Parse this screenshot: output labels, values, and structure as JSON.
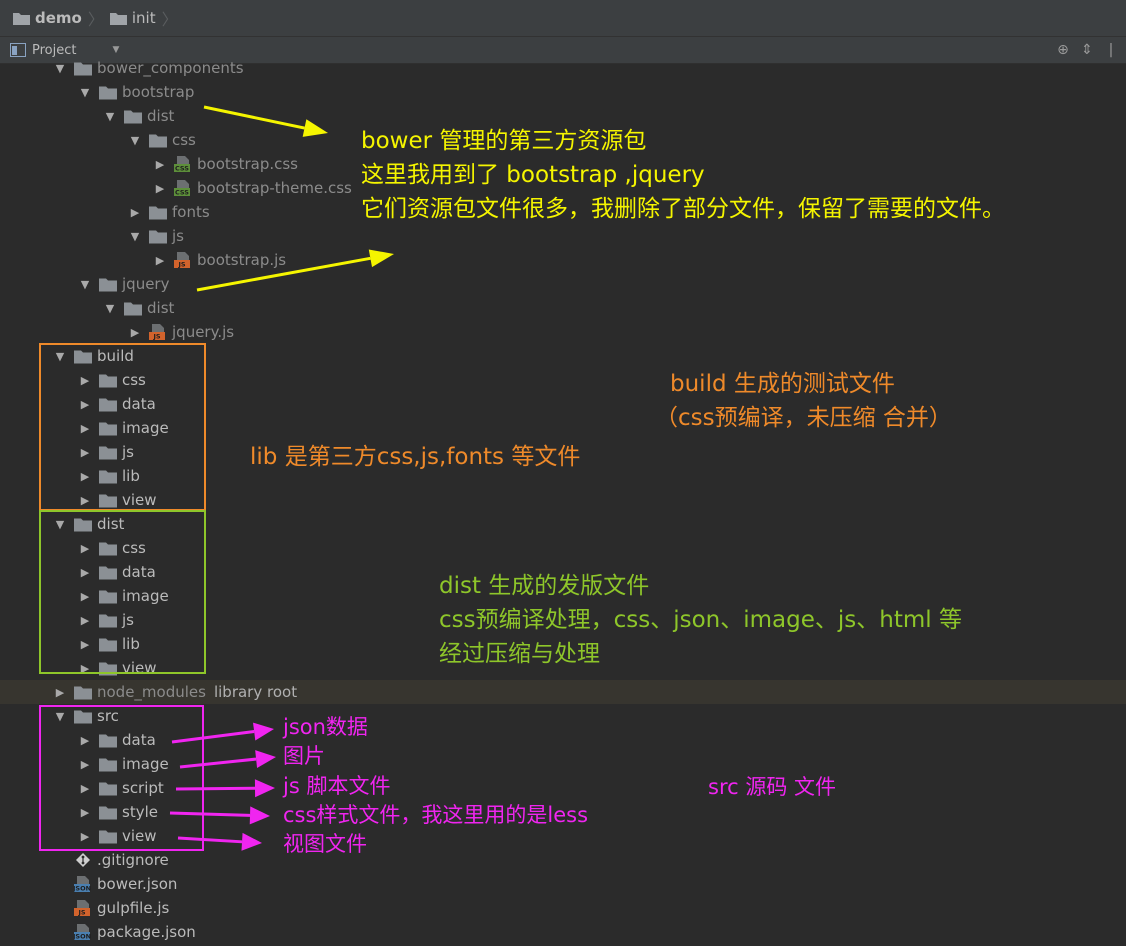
{
  "breadcrumb": {
    "items": [
      "demo",
      "init"
    ]
  },
  "toolbar": {
    "project_label": "Project"
  },
  "tree": [
    {
      "label": "bower_components",
      "icon": "folder-icon",
      "expanded": true,
      "depth": 0,
      "dim": true
    },
    {
      "label": "bootstrap",
      "icon": "folder-icon",
      "expanded": true,
      "depth": 1,
      "dim": true
    },
    {
      "label": "dist",
      "icon": "folder-icon",
      "expanded": true,
      "depth": 2,
      "dim": true
    },
    {
      "label": "css",
      "icon": "folder-icon",
      "expanded": true,
      "depth": 3,
      "dim": true
    },
    {
      "label": "bootstrap.css",
      "icon": "css-file-icon",
      "expanded": false,
      "depth": 4,
      "dim": true
    },
    {
      "label": "bootstrap-theme.css",
      "icon": "css-file-icon",
      "expanded": false,
      "depth": 4,
      "dim": true
    },
    {
      "label": "fonts",
      "icon": "folder-icon",
      "expanded": false,
      "depth": 3,
      "dim": true
    },
    {
      "label": "js",
      "icon": "folder-icon",
      "expanded": true,
      "depth": 3,
      "dim": true
    },
    {
      "label": "bootstrap.js",
      "icon": "js-file-icon",
      "expanded": false,
      "depth": 4,
      "dim": true
    },
    {
      "label": "jquery",
      "icon": "folder-icon",
      "expanded": true,
      "depth": 1,
      "dim": true
    },
    {
      "label": "dist",
      "icon": "folder-icon",
      "expanded": true,
      "depth": 2,
      "dim": true
    },
    {
      "label": "jquery.js",
      "icon": "js-file-icon",
      "expanded": false,
      "depth": 3,
      "dim": true
    },
    {
      "label": "build",
      "icon": "folder-icon",
      "expanded": true,
      "depth": 0
    },
    {
      "label": "css",
      "icon": "folder-icon",
      "expanded": false,
      "depth": 1
    },
    {
      "label": "data",
      "icon": "folder-icon",
      "expanded": false,
      "depth": 1
    },
    {
      "label": "image",
      "icon": "folder-icon",
      "expanded": false,
      "depth": 1
    },
    {
      "label": "js",
      "icon": "folder-icon",
      "expanded": false,
      "depth": 1
    },
    {
      "label": "lib",
      "icon": "folder-icon",
      "expanded": false,
      "depth": 1
    },
    {
      "label": "view",
      "icon": "folder-icon",
      "expanded": false,
      "depth": 1
    },
    {
      "label": "dist",
      "icon": "folder-icon",
      "expanded": true,
      "depth": 0
    },
    {
      "label": "css",
      "icon": "folder-icon",
      "expanded": false,
      "depth": 1
    },
    {
      "label": "data",
      "icon": "folder-icon",
      "expanded": false,
      "depth": 1
    },
    {
      "label": "image",
      "icon": "folder-icon",
      "expanded": false,
      "depth": 1
    },
    {
      "label": "js",
      "icon": "folder-icon",
      "expanded": false,
      "depth": 1
    },
    {
      "label": "lib",
      "icon": "folder-icon",
      "expanded": false,
      "depth": 1
    },
    {
      "label": "view",
      "icon": "folder-icon",
      "expanded": false,
      "depth": 1
    },
    {
      "label": "node_modules",
      "suffix": "library root",
      "icon": "folder-icon",
      "expanded": false,
      "depth": 0,
      "dim": true,
      "highlight": true
    },
    {
      "label": "src",
      "icon": "folder-icon",
      "expanded": true,
      "depth": 0
    },
    {
      "label": "data",
      "icon": "folder-icon",
      "expanded": false,
      "depth": 1
    },
    {
      "label": "image",
      "icon": "folder-icon",
      "expanded": false,
      "depth": 1
    },
    {
      "label": "script",
      "icon": "folder-icon",
      "expanded": false,
      "depth": 1
    },
    {
      "label": "style",
      "icon": "folder-icon",
      "expanded": false,
      "depth": 1
    },
    {
      "label": "view",
      "icon": "folder-icon",
      "expanded": false,
      "depth": 1
    },
    {
      "label": ".gitignore",
      "icon": "git-file-icon",
      "expanded": null,
      "depth": 0
    },
    {
      "label": "bower.json",
      "icon": "json-file-icon",
      "expanded": null,
      "depth": 0
    },
    {
      "label": "gulpfile.js",
      "icon": "js-file-icon",
      "expanded": null,
      "depth": 0
    },
    {
      "label": "package.json",
      "icon": "json-file-icon",
      "expanded": null,
      "depth": 0
    }
  ],
  "annotations": {
    "bower": [
      "bower 管理的第三方资源包",
      "这里我用到了 bootstrap ,jquery",
      "它们资源包文件很多，我删除了部分文件，保留了需要的文件。"
    ],
    "build": [
      "build 生成的测试文件",
      "（css预编译，未压缩 合并）"
    ],
    "lib": "lib 是第三方css,js,fonts 等文件",
    "dist": [
      "dist 生成的发版文件",
      "css预编译处理，css、json、image、js、html 等",
      "经过压缩与处理"
    ],
    "src_items": [
      "json数据",
      "图片",
      "js 脚本文件",
      "css样式文件，我这里用的是less",
      "视图文件"
    ],
    "src": "src 源码 文件"
  },
  "colors": {
    "yellow": "#f5f500",
    "orange": "#ef8a2a",
    "green": "#8ec62a",
    "magenta": "#f025f0"
  }
}
